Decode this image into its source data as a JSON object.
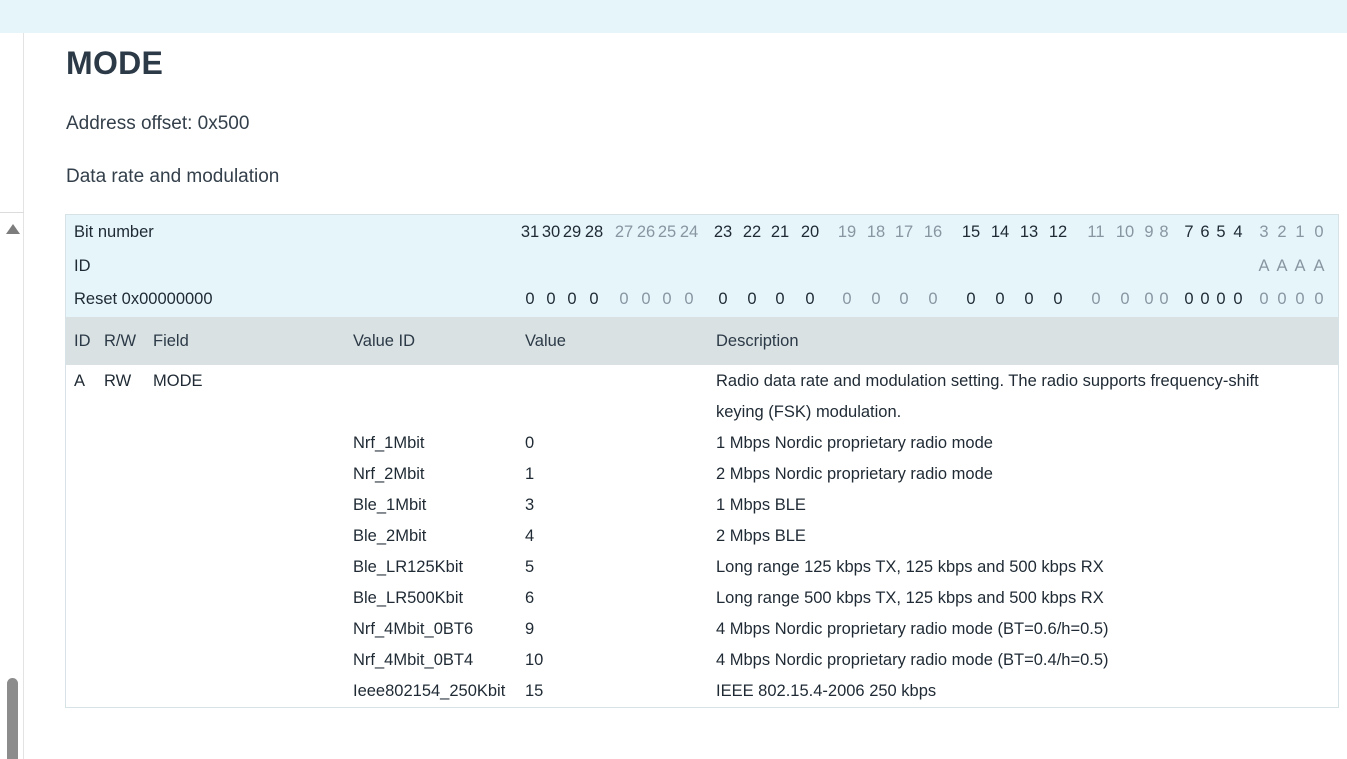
{
  "page": {
    "title": "MODE",
    "address_offset": "Address offset: 0x500",
    "description": "Data rate and modulation"
  },
  "bit_table": {
    "bit_number_label": "Bit number",
    "id_label": "ID",
    "reset_label": "Reset 0x00000000",
    "bits": [
      "31",
      "30",
      "29",
      "28",
      "27",
      "26",
      "25",
      "24",
      "23",
      "22",
      "21",
      "20",
      "19",
      "18",
      "17",
      "16",
      "15",
      "14",
      "13",
      "12",
      "11",
      "10",
      "9",
      "8",
      "7",
      "6",
      "5",
      "4",
      "3",
      "2",
      "1",
      "0"
    ],
    "ids": [
      "A",
      "A",
      "A",
      "A"
    ],
    "reset_values": [
      "0",
      "0",
      "0",
      "0",
      "0",
      "0",
      "0",
      "0",
      "0",
      "0",
      "0",
      "0",
      "0",
      "0",
      "0",
      "0",
      "0",
      "0",
      "0",
      "0",
      "0",
      "0",
      "0",
      "0",
      "0",
      "0",
      "0",
      "0",
      "0",
      "0",
      "0",
      "0"
    ]
  },
  "field_table": {
    "headers": {
      "id": "ID",
      "rw": "R/W",
      "field": "Field",
      "value_id": "Value ID",
      "value": "Value",
      "description": "Description"
    },
    "field": {
      "id": "A",
      "rw": "RW",
      "name": "MODE",
      "description_line1": "Radio data rate and modulation setting. The radio supports frequency-shift",
      "description_line2": "keying (FSK) modulation."
    },
    "values": [
      {
        "value_id": "Nrf_1Mbit",
        "value": "0",
        "description": "1 Mbps Nordic proprietary radio mode"
      },
      {
        "value_id": "Nrf_2Mbit",
        "value": "1",
        "description": "2 Mbps Nordic proprietary radio mode"
      },
      {
        "value_id": "Ble_1Mbit",
        "value": "3",
        "description": "1 Mbps BLE"
      },
      {
        "value_id": "Ble_2Mbit",
        "value": "4",
        "description": "2 Mbps BLE"
      },
      {
        "value_id": "Ble_LR125Kbit",
        "value": "5",
        "description": "Long range 125 kbps TX, 125 kbps and 500 kbps RX"
      },
      {
        "value_id": "Ble_LR500Kbit",
        "value": "6",
        "description": "Long range 500 kbps TX, 125 kbps and 500 kbps RX"
      },
      {
        "value_id": "Nrf_4Mbit_0BT6",
        "value": "9",
        "description": "4 Mbps Nordic proprietary radio mode (BT=0.6/h=0.5)"
      },
      {
        "value_id": "Nrf_4Mbit_0BT4",
        "value": "10",
        "description": "4 Mbps Nordic proprietary radio mode (BT=0.4/h=0.5)"
      },
      {
        "value_id": "Ieee802154_250Kbit",
        "value": "15",
        "description": "IEEE 802.15.4-2006 250 kbps"
      }
    ]
  },
  "icons": {
    "scroll_up": "scroll-up-arrow-icon"
  }
}
